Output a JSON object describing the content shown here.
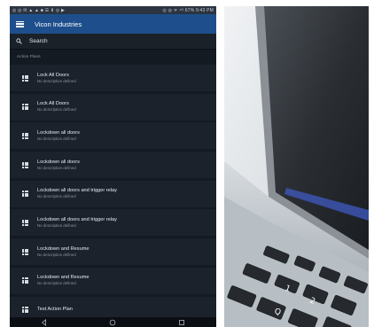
{
  "status_bar": {
    "left_icons": "◎ ◎ ✉ ▲ ▲ ■ ☰ ⬇ ◎ ▶",
    "right_icons": "◎ ◎ ᯤ ⁴ᴳ",
    "battery": "67%",
    "time": "9:43 PM"
  },
  "app_bar": {
    "title": "Vicon Industries"
  },
  "search": {
    "label": "Search"
  },
  "section": {
    "title": "Action Plans"
  },
  "items": [
    {
      "title": "Lock All Doors",
      "desc": "No description defined"
    },
    {
      "title": "Lock All Doors",
      "desc": "No description defined"
    },
    {
      "title": "Lockdown all doors",
      "desc": "No description defined"
    },
    {
      "title": "Lockdown all doors",
      "desc": "No description defined"
    },
    {
      "title": "Lockdown all doors and trigger relay",
      "desc": "No description defined"
    },
    {
      "title": "Lockdown all doors and trigger relay",
      "desc": "No description defined"
    },
    {
      "title": "Lockdown and Resume",
      "desc": "No description defined"
    },
    {
      "title": "Lockdown and Resume",
      "desc": "No description defined"
    },
    {
      "title": "Test Action Plan",
      "desc": ""
    }
  ],
  "icons": {
    "menu": "menu-icon",
    "search": "search-icon",
    "item": "grid-icon",
    "nav_back": "back-icon",
    "nav_home": "home-icon",
    "nav_recents": "recents-icon"
  },
  "colors": {
    "app_bar": "#1e4f8c",
    "background": "#141a22",
    "list_item": "#1b222b"
  }
}
